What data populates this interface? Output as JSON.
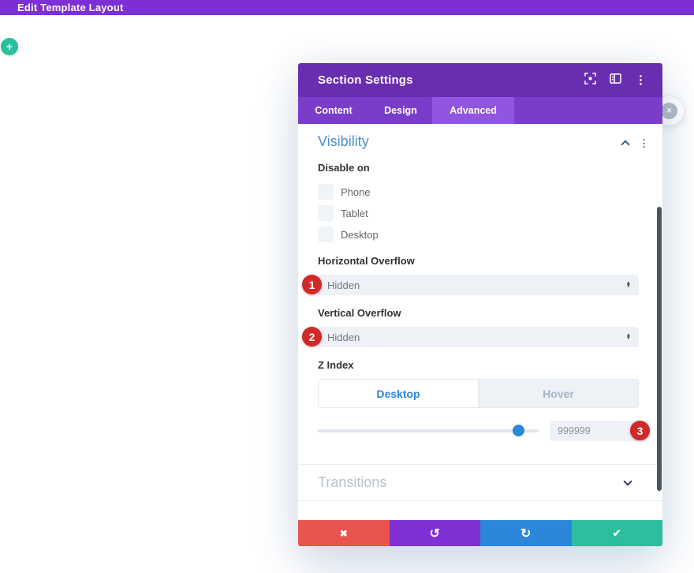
{
  "top_bar": {
    "title": "Edit Template Layout"
  },
  "floating": {
    "add_label": "+",
    "close_glyph": "✕"
  },
  "modal": {
    "title": "Section Settings",
    "tabs": [
      {
        "label": "Content",
        "active": false
      },
      {
        "label": "Design",
        "active": false
      },
      {
        "label": "Advanced",
        "active": true
      }
    ]
  },
  "visibility": {
    "title": "Visibility",
    "disable_on": {
      "label": "Disable on",
      "options": [
        {
          "label": "Phone",
          "checked": false
        },
        {
          "label": "Tablet",
          "checked": false
        },
        {
          "label": "Desktop",
          "checked": false
        }
      ]
    },
    "horizontal_overflow": {
      "label": "Horizontal Overflow",
      "value": "Hidden"
    },
    "vertical_overflow": {
      "label": "Vertical Overflow",
      "value": "Hidden"
    },
    "z_index": {
      "label": "Z Index",
      "device_tabs": [
        {
          "label": "Desktop",
          "active": true
        },
        {
          "label": "Hover",
          "active": false
        }
      ],
      "value": "999999"
    }
  },
  "transitions": {
    "title": "Transitions"
  },
  "annotations": {
    "badges": [
      "1",
      "2",
      "3"
    ]
  },
  "icons": {
    "sort_up": "▲",
    "sort_down": "▼",
    "kebab": "⋮",
    "discard": "✖",
    "undo": "↺",
    "redo": "↻",
    "save": "✔"
  },
  "colors": {
    "top_bar_purple": "#7c2fd4",
    "modal_header_purple": "#692db0",
    "tab_bar_purple": "#7b3cc9",
    "active_tab_purple": "#9155df",
    "section_title_blue": "#4a8ecd",
    "accent_blue": "#2b87da",
    "badge_red": "#d02929",
    "footer_red": "#e8544e",
    "footer_purple": "#7e30d4",
    "footer_blue": "#2b87da",
    "footer_green": "#2cbe9d",
    "add_button_green": "#2abf9d",
    "control_bg": "#eef1f6",
    "scrollbar_slate": "#4b5561"
  }
}
